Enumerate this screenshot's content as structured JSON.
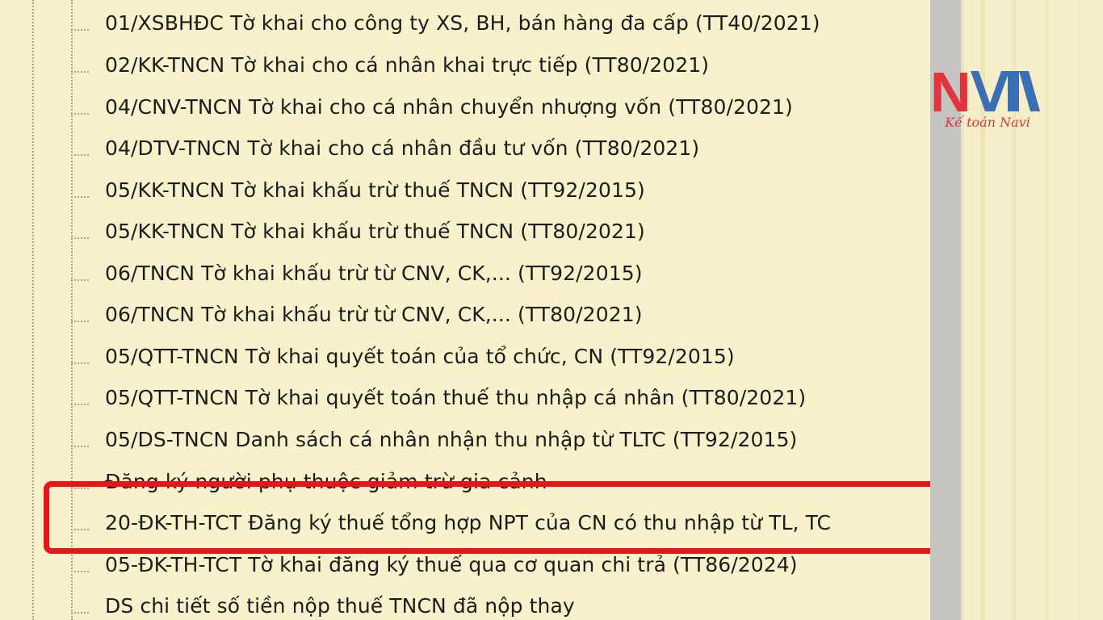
{
  "tree": {
    "items": [
      {
        "label": "01/XSBHĐC Tờ khai cho công ty XS, BH, bán hàng đa cấp (TT40/2021)"
      },
      {
        "label": "02/KK-TNCN Tờ khai cho cá nhân khai trực tiếp (TT80/2021)"
      },
      {
        "label": "04/CNV-TNCN Tờ khai cho cá nhân chuyển nhượng vốn (TT80/2021)"
      },
      {
        "label": "04/DTV-TNCN Tờ khai cho cá nhân đầu tư vốn (TT80/2021)"
      },
      {
        "label": "05/KK-TNCN Tờ khai khấu trừ thuế TNCN (TT92/2015)"
      },
      {
        "label": "05/KK-TNCN Tờ khai khấu trừ thuế TNCN (TT80/2021)"
      },
      {
        "label": "06/TNCN Tờ khai khấu trừ từ CNV, CK,... (TT92/2015)"
      },
      {
        "label": "06/TNCN Tờ khai khấu trừ từ CNV, CK,... (TT80/2021)"
      },
      {
        "label": "05/QTT-TNCN Tờ khai quyết toán của tổ chức, CN (TT92/2015)"
      },
      {
        "label": "05/QTT-TNCN Tờ khai quyết toán thuế thu nhập cá nhân (TT80/2021)"
      },
      {
        "label": "05/DS-TNCN Danh sách cá nhân nhận thu nhập từ TLTC (TT92/2015)"
      },
      {
        "label": "Đăng ký người phụ thuộc giảm trừ gia cảnh"
      },
      {
        "label": "20-ĐK-TH-TCT Đăng ký thuế tổng hợp NPT của CN có thu nhập từ TL, TC"
      },
      {
        "label": "05-ĐK-TH-TCT Tờ khai đăng ký thuế qua cơ quan chi trả (TT86/2024)"
      },
      {
        "label": "DS chi tiết số tiền nộp thuế TNCN đã nộp thay"
      }
    ],
    "highlighted_index": 12,
    "highlight_color": "#e8141a"
  },
  "logo": {
    "brand_letters": "NAVI",
    "tagline": "Kế toán Navi",
    "color_red": "#e2343c",
    "color_blue": "#3a6fb5"
  }
}
